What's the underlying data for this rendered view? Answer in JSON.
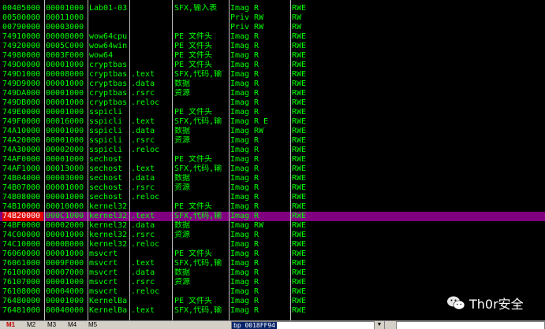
{
  "rows": [
    [
      "00405000",
      "00001000",
      "Lab01-03",
      "",
      "SFX,输入表",
      "Imag",
      "R",
      "RWE"
    ],
    [
      "00500000",
      "00011000",
      "",
      "",
      "",
      "Priv",
      "RW",
      "RW"
    ],
    [
      "00790000",
      "00003000",
      "",
      "",
      "",
      "Priv",
      "RW",
      "RW"
    ],
    [
      "74910000",
      "00008000",
      "wow64cpu",
      "",
      "PE 文件头",
      "Imag",
      "R",
      "RWE"
    ],
    [
      "74920000",
      "0005C000",
      "wow64win",
      "",
      "PE 文件头",
      "Imag",
      "R",
      "RWE"
    ],
    [
      "74980000",
      "0003F000",
      "wow64",
      "",
      "PE 文件头",
      "Imag",
      "R",
      "RWE"
    ],
    [
      "749D0000",
      "00001000",
      "cryptbas",
      "",
      "PE 文件头",
      "Imag",
      "R",
      "RWE"
    ],
    [
      "749D1000",
      "00008000",
      "cryptbas",
      ".text",
      "SFX,代码,输",
      "Imag",
      "R",
      "RWE"
    ],
    [
      "749D9000",
      "00001000",
      "cryptbas",
      ".data",
      "数据",
      "Imag",
      "R",
      "RWE"
    ],
    [
      "749DA000",
      "00001000",
      "cryptbas",
      ".rsrc",
      "资源",
      "Imag",
      "R",
      "RWE"
    ],
    [
      "749DB000",
      "00001000",
      "cryptbas",
      ".reloc",
      "",
      "Imag",
      "R",
      "RWE"
    ],
    [
      "749E0000",
      "00001000",
      "sspicli",
      "",
      "PE 文件头",
      "Imag",
      "R",
      "RWE"
    ],
    [
      "749F0000",
      "00016000",
      "sspicli",
      ".text",
      "SFX,代码,输",
      "Imag",
      "R E",
      "RWE"
    ],
    [
      "74A10000",
      "00001000",
      "sspicli",
      ".data",
      "数据",
      "Imag",
      "RW",
      "RWE"
    ],
    [
      "74A20000",
      "00001000",
      "sspicli",
      ".rsrc",
      "资源",
      "Imag",
      "R",
      "RWE"
    ],
    [
      "74A30000",
      "00002000",
      "sspicli",
      ".reloc",
      "",
      "Imag",
      "R",
      "RWE"
    ],
    [
      "74AF0000",
      "00001000",
      "sechost",
      "",
      "PE 文件头",
      "Imag",
      "R",
      "RWE"
    ],
    [
      "74AF1000",
      "00013000",
      "sechost",
      ".text",
      "SFX,代码,输",
      "Imag",
      "R",
      "RWE"
    ],
    [
      "74B04000",
      "00003000",
      "sechost",
      ".data",
      "数据",
      "Imag",
      "R",
      "RWE"
    ],
    [
      "74B07000",
      "00001000",
      "sechost",
      ".rsrc",
      "资源",
      "Imag",
      "R",
      "RWE"
    ],
    [
      "74B08000",
      "00001000",
      "sechost",
      ".reloc",
      "",
      "Imag",
      "R",
      "RWE"
    ],
    [
      "74B10000",
      "00010000",
      "kernel32",
      "",
      "PE 文件头",
      "Imag",
      "R",
      "RWE"
    ],
    [
      "74B20000",
      "000C1000",
      "kernel32",
      ".text",
      "SFX,代码,输",
      "Imag",
      "R",
      "RWE"
    ],
    [
      "74BF0000",
      "00002000",
      "kernel32",
      ".data",
      "数据",
      "Imag",
      "RW",
      "RWE"
    ],
    [
      "74C00000",
      "00001000",
      "kernel32",
      ".rsrc",
      "资源",
      "Imag",
      "R",
      "RWE"
    ],
    [
      "74C10000",
      "0000B000",
      "kernel32",
      ".reloc",
      "",
      "Imag",
      "R",
      "RWE"
    ],
    [
      "76060000",
      "00001000",
      "msvcrt",
      "",
      "PE 文件头",
      "Imag",
      "R",
      "RWE"
    ],
    [
      "76061000",
      "0009F000",
      "msvcrt",
      ".text",
      "SFX,代码,输",
      "Imag",
      "R",
      "RWE"
    ],
    [
      "76100000",
      "00007000",
      "msvcrt",
      ".data",
      "数据",
      "Imag",
      "R",
      "RWE"
    ],
    [
      "76107000",
      "00001000",
      "msvcrt",
      ".rsrc",
      "资源",
      "Imag",
      "R",
      "RWE"
    ],
    [
      "76108000",
      "00004000",
      "msvcrt",
      ".reloc",
      "",
      "Imag",
      "R",
      "RWE"
    ],
    [
      "76480000",
      "00001000",
      "KernelBa",
      "",
      "PE 文件头",
      "Imag",
      "R",
      "RWE"
    ],
    [
      "76481000",
      "00040000",
      "KernelBa",
      ".text",
      "SFX,代码,输",
      "Imag",
      "R",
      "RWE"
    ]
  ],
  "selected_row_index": 22,
  "statusbar": {
    "tabs": [
      "M1",
      "M2",
      "M3",
      "M4",
      "M5"
    ],
    "active_tab_index": 0,
    "command_value": "bp 0018FF94"
  },
  "watermark": {
    "text": "Th0r安全",
    "icon": "wechat-icon"
  },
  "colors": {
    "text": "#00ff00",
    "background": "#000000",
    "selected_row": "#800080",
    "selected_addr": "#e00000"
  }
}
